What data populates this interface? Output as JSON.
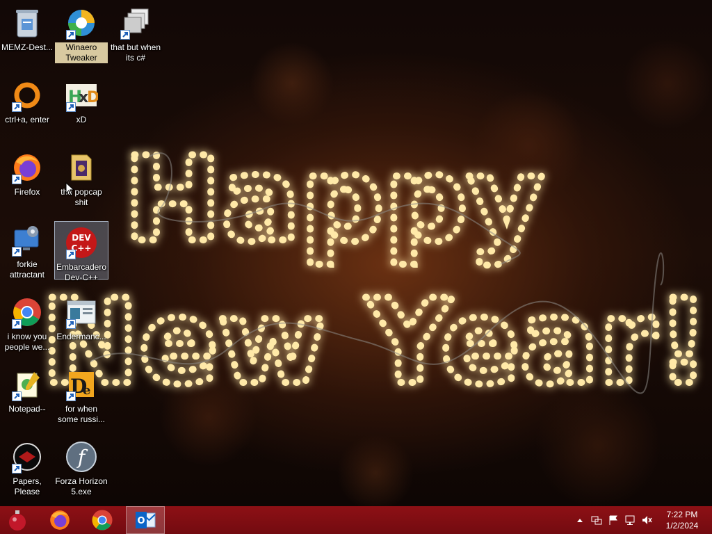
{
  "wallpaper": {
    "line1": "Happy",
    "line2": "New Year!",
    "glow_color": "#ffe9a8",
    "light_color": "#fff6d0"
  },
  "desktop_icons": [
    {
      "label": "MEMZ-Dest...",
      "icon": "recycle-bin-icon"
    },
    {
      "label": "Winaero Tweaker",
      "icon": "winaero-tweaker-icon"
    },
    {
      "label": "that but when its c#",
      "icon": "stacked-windows-icon"
    },
    {
      "label": "ctrl+a, enter",
      "icon": "orange-ring-icon"
    },
    {
      "label": "xD",
      "icon": "hxd-icon"
    },
    {
      "label": "Firefox",
      "icon": "firefox-icon"
    },
    {
      "label": "the popcap shit",
      "icon": "folder-icon"
    },
    {
      "label": "forkie attractant",
      "icon": "settings-monitor-icon"
    },
    {
      "label": "Embarcadero Dev-C++",
      "icon": "dev-cpp-icon"
    },
    {
      "label": "i know you people we...",
      "icon": "chrome-icon"
    },
    {
      "label": "Endermanc...",
      "icon": "window-app-icon"
    },
    {
      "label": "Notepad--",
      "icon": "notepad-icon"
    },
    {
      "label": "for when some russi...",
      "icon": "djvu-icon"
    },
    {
      "label": "Papers, Please",
      "icon": "papers-please-icon"
    },
    {
      "label": "Forza Horizon 5.exe",
      "icon": "flash-icon"
    }
  ],
  "taskbar": {
    "start_icon": "ornament-start-icon",
    "pinned": [
      "firefox-icon",
      "chrome-icon",
      "outlook-icon"
    ],
    "color": "#8d1015"
  },
  "tray": {
    "icons": [
      "show-hidden-icons-chevron",
      "network-icon",
      "flag-icon",
      "ethernet-icon",
      "volume-muted-icon"
    ],
    "time": "7:22 PM",
    "date": "1/2/2024"
  }
}
